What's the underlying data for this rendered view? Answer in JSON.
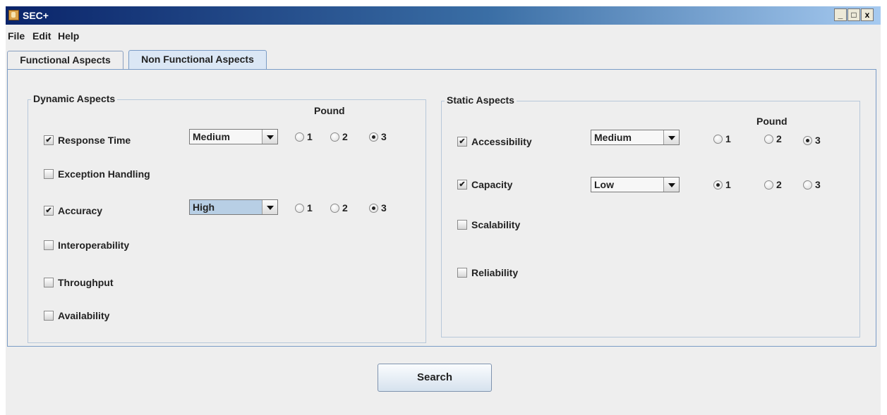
{
  "window": {
    "title": "SEC+"
  },
  "titlebar_buttons": {
    "minimize": "_",
    "maximize": "□",
    "close": "x"
  },
  "menu": [
    "File",
    "Edit",
    "Help"
  ],
  "tabs": [
    {
      "label": "Functional Aspects",
      "active": false
    },
    {
      "label": "Non Functional Aspects",
      "active": true
    }
  ],
  "dynamic": {
    "title": "Dynamic Aspects",
    "pound_label": "Pound",
    "items": [
      {
        "label": "Response Time",
        "checked": true,
        "level": "Medium",
        "pound": 3
      },
      {
        "label": "Exception Handling",
        "checked": false
      },
      {
        "label": "Accuracy",
        "checked": true,
        "level": "High",
        "pound": 3
      },
      {
        "label": "Interoperability",
        "checked": false
      },
      {
        "label": "Throughput",
        "checked": false
      },
      {
        "label": "Availability",
        "checked": false
      }
    ]
  },
  "static": {
    "title": "Static Aspects",
    "pound_label": "Pound",
    "items": [
      {
        "label": "Accessibility",
        "checked": true,
        "level": "Medium",
        "pound": 3
      },
      {
        "label": "Capacity",
        "checked": true,
        "level": "Low",
        "pound": 1
      },
      {
        "label": "Scalability",
        "checked": false
      },
      {
        "label": "Reliability",
        "checked": false
      }
    ]
  },
  "radio_labels": [
    "1",
    "2",
    "3"
  ],
  "check_mark": "✔",
  "search_button": "Search"
}
